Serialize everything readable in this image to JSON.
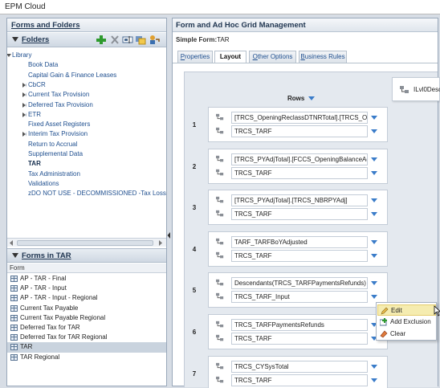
{
  "app": {
    "title": "EPM Cloud"
  },
  "left_panel": {
    "title": "Forms and Folders",
    "folders_header": "Folders",
    "tree": [
      {
        "label": "Library",
        "indent": 0,
        "arrow": "down"
      },
      {
        "label": "Book Data",
        "indent": 1,
        "arrow": ""
      },
      {
        "label": "Capital Gain & Finance Leases",
        "indent": 1,
        "arrow": ""
      },
      {
        "label": "CbCR",
        "indent": 1,
        "arrow": "right"
      },
      {
        "label": "Current Tax Provision",
        "indent": 1,
        "arrow": "right"
      },
      {
        "label": "Deferred Tax Provision",
        "indent": 1,
        "arrow": "right"
      },
      {
        "label": "ETR",
        "indent": 1,
        "arrow": "right"
      },
      {
        "label": "Fixed Asset Registers",
        "indent": 1,
        "arrow": ""
      },
      {
        "label": "Interim Tax Provision",
        "indent": 1,
        "arrow": "right"
      },
      {
        "label": "Return to Accrual",
        "indent": 1,
        "arrow": ""
      },
      {
        "label": "Supplemental Data",
        "indent": 1,
        "arrow": ""
      },
      {
        "label": "TAR",
        "indent": 1,
        "arrow": "",
        "selected": true
      },
      {
        "label": "Tax Administration",
        "indent": 1,
        "arrow": ""
      },
      {
        "label": "Validations",
        "indent": 1,
        "arrow": ""
      },
      {
        "label": "zDO NOT USE - DECOMMISSIONED -Tax Losses a",
        "indent": 1,
        "arrow": ""
      }
    ],
    "forms_header": "Forms in TAR",
    "forms_column": "Form",
    "forms": [
      {
        "label": "AP - TAR - Final"
      },
      {
        "label": "AP - TAR - Input"
      },
      {
        "label": "AP - TAR - Input - Regional"
      },
      {
        "label": "Current Tax Payable"
      },
      {
        "label": "Current Tax Payable Regional"
      },
      {
        "label": "Deferred Tax for TAR"
      },
      {
        "label": "Deferred Tax for TAR Regional"
      },
      {
        "label": "TAR",
        "selected": true
      },
      {
        "label": "TAR Regional"
      }
    ]
  },
  "right_panel": {
    "title": "Form and Ad Hoc Grid Management",
    "simple_form_label": "Simple Form:",
    "simple_form_value": "TAR",
    "tabs": [
      {
        "label": "Properties",
        "underline": "P",
        "active": false
      },
      {
        "label": "Layout",
        "underline": "",
        "active": true
      },
      {
        "label": "Other Options",
        "underline": "O",
        "active": false
      },
      {
        "label": "Business Rules",
        "underline": "B",
        "active": false
      }
    ],
    "rows_label": "Rows",
    "pov_label": "ILvl0Desc",
    "rows": [
      {
        "num": "1",
        "members": [
          "[TRCS_OpeningReclassDTNRTotal].[TRCS_Ope",
          "TRCS_TARF"
        ]
      },
      {
        "num": "2",
        "members": [
          "[TRCS_PYAdjTotal].[FCCS_OpeningBalanceAdj",
          "TRCS_TARF"
        ]
      },
      {
        "num": "3",
        "members": [
          "[TRCS_PYAdjTotal].[TRCS_NBRPYAdj]",
          "TRCS_TARF"
        ]
      },
      {
        "num": "4",
        "members": [
          "TARF_TARFBoYAdjusted",
          "TRCS_TARF"
        ]
      },
      {
        "num": "5",
        "members": [
          "Descendants(TRCS_TARFPaymentsRefunds)",
          "TRCS_TARF_Input"
        ]
      },
      {
        "num": "6",
        "members": [
          "TRCS_TARFPaymentsRefunds",
          "TRCS_TARF"
        ]
      },
      {
        "num": "7",
        "members": [
          "TRCS_CYSysTotal",
          "TRCS_TARF"
        ]
      }
    ]
  },
  "context_menu": {
    "items": [
      {
        "label": "Edit",
        "icon": "pencil-icon",
        "highlighted": true
      },
      {
        "label": "Add Exclusion",
        "icon": "add-exclusion-icon",
        "highlighted": false
      },
      {
        "label": "Clear",
        "icon": "eraser-icon",
        "highlighted": false
      }
    ]
  }
}
